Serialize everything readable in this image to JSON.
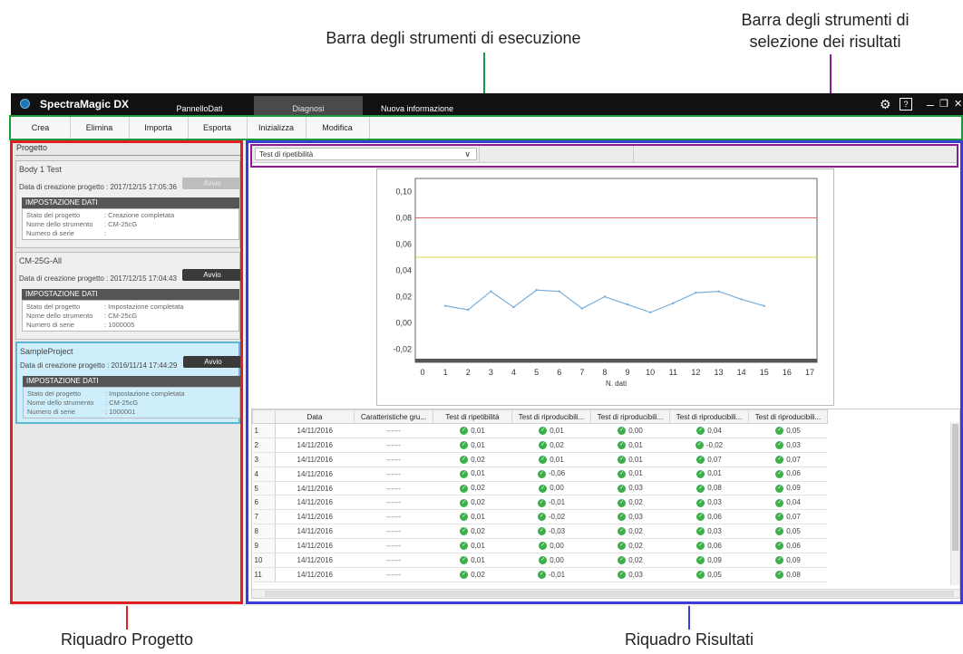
{
  "annotations": {
    "exec_toolbar": "Barra degli strumenti di esecuzione",
    "sel_toolbar_line1": "Barra degli strumenti di",
    "sel_toolbar_line2": "selezione dei risultati",
    "project_pane": "Riquadro Progetto",
    "results_pane": "Riquadro Risultati"
  },
  "colors": {
    "exec_toolbar": "#1a9a3a",
    "sel_toolbar": "#8e1a9a",
    "project_pane": "#e02020",
    "results_pane": "#3b3bd6"
  },
  "app": {
    "name": "SpectraMagic DX",
    "tabs": [
      "PannelloDati",
      "Diagnosi",
      "Nuova informazione"
    ],
    "active_tab": "Diagnosi",
    "controls": [
      "settings-icon",
      "help-icon",
      "minimize-icon",
      "restore-icon",
      "close-icon"
    ],
    "help_label": "?"
  },
  "toolbar": {
    "items": [
      "Crea",
      "Elimina",
      "Importa",
      "Esporta",
      "Inizializza",
      "Modifica"
    ]
  },
  "project_pane": {
    "title": "Progetto",
    "projects": [
      {
        "name": "Body 1 Test",
        "date": "Data di creazione progetto : 2017/12/15 17:05:36",
        "button": "Avvio",
        "settings_header": "IMPOSTAZIONE DATI",
        "state_label": "Stato del progetto",
        "state": ": Creazione completata",
        "instrument_label": "Nome dello strumento",
        "instrument": ": CM-25cG",
        "serial_label": "Numero di serie",
        "serial": ":"
      },
      {
        "name": "CM-25G-All",
        "date": "Data di creazione progetto : 2017/12/15 17:04:43",
        "button": "Avvio",
        "settings_header": "IMPOSTAZIONE DATI",
        "state_label": "Stato del progetto",
        "state": ": Impostazione completata",
        "instrument_label": "Nome dello strumento",
        "instrument": ": CM-25cG",
        "serial_label": "Numero di serie",
        "serial": ": 1000005"
      },
      {
        "name": "SampleProject",
        "date": "Data di creazione progetto : 2016/11/14 17:44:29",
        "button": "Avvio",
        "settings_header": "IMPOSTAZIONE DATI",
        "state_label": "Stato del progetto",
        "state": ": Impostazione completata",
        "instrument_label": "Nome dello strumento",
        "instrument": ": CM-25cG",
        "serial_label": "Numero di serie",
        "serial": ": 1000001"
      }
    ]
  },
  "results": {
    "selected_test": "Test di ripetibilità",
    "table": {
      "headers": [
        "Data",
        "Caratteristiche gru...",
        "Test di ripetibilità",
        "Test di riproducibili...",
        "Test di riproducibili...",
        "Test di riproducibili...",
        "Test di riproducibili..."
      ],
      "rows": [
        [
          "1",
          "14/11/2016",
          "------",
          "0,01",
          "0,01",
          "0,00",
          "0,04",
          "0,05"
        ],
        [
          "2",
          "14/11/2016",
          "------",
          "0,01",
          "0,02",
          "0,01",
          "-0,02",
          "0,03"
        ],
        [
          "3",
          "14/11/2016",
          "------",
          "0,02",
          "0,01",
          "0,01",
          "0,07",
          "0,07"
        ],
        [
          "4",
          "14/11/2016",
          "------",
          "0,01",
          "-0,06",
          "0,01",
          "0,01",
          "0,06"
        ],
        [
          "5",
          "14/11/2016",
          "------",
          "0,02",
          "0,00",
          "0,03",
          "0,08",
          "0,09"
        ],
        [
          "6",
          "14/11/2016",
          "------",
          "0,02",
          "-0,01",
          "0,02",
          "0,03",
          "0,04"
        ],
        [
          "7",
          "14/11/2016",
          "------",
          "0,01",
          "-0,02",
          "0,03",
          "0,06",
          "0,07"
        ],
        [
          "8",
          "14/11/2016",
          "------",
          "0,02",
          "-0,03",
          "0,02",
          "0,03",
          "0,05"
        ],
        [
          "9",
          "14/11/2016",
          "------",
          "0,01",
          "0,00",
          "0,02",
          "0,06",
          "0,06"
        ],
        [
          "10",
          "14/11/2016",
          "------",
          "0,01",
          "0,00",
          "0,02",
          "0,09",
          "0,09"
        ],
        [
          "11",
          "14/11/2016",
          "------",
          "0,02",
          "-0,01",
          "0,03",
          "0,05",
          "0,08"
        ]
      ]
    }
  },
  "chart_data": {
    "type": "line",
    "xlabel": "N. dati",
    "xlim": [
      0,
      17
    ],
    "ylim": [
      -0.03,
      0.11
    ],
    "x_ticks": [
      0,
      1,
      2,
      3,
      4,
      5,
      6,
      7,
      8,
      9,
      10,
      11,
      12,
      13,
      14,
      15,
      16,
      17
    ],
    "y_ticks": [
      "0,10",
      "0,08",
      "0,06",
      "0,04",
      "0,02",
      "0,00",
      "-0,02"
    ],
    "y_tick_values": [
      0.1,
      0.08,
      0.06,
      0.04,
      0.02,
      0.0,
      -0.02
    ],
    "series": [
      {
        "x": [
          1,
          2,
          3,
          4,
          5,
          6,
          7,
          8,
          9,
          10,
          11,
          12,
          13,
          14,
          15
        ],
        "y": [
          0.013,
          0.01,
          0.024,
          0.012,
          0.025,
          0.024,
          0.011,
          0.02,
          0.014,
          0.008,
          0.015,
          0.023,
          0.024,
          0.018,
          0.013
        ],
        "color": "#7aaed8"
      }
    ],
    "reference_lines": [
      {
        "y": 0.08,
        "color": "#e06b6b"
      },
      {
        "y": 0.05,
        "color": "#e8d64a"
      }
    ],
    "grid": false
  }
}
